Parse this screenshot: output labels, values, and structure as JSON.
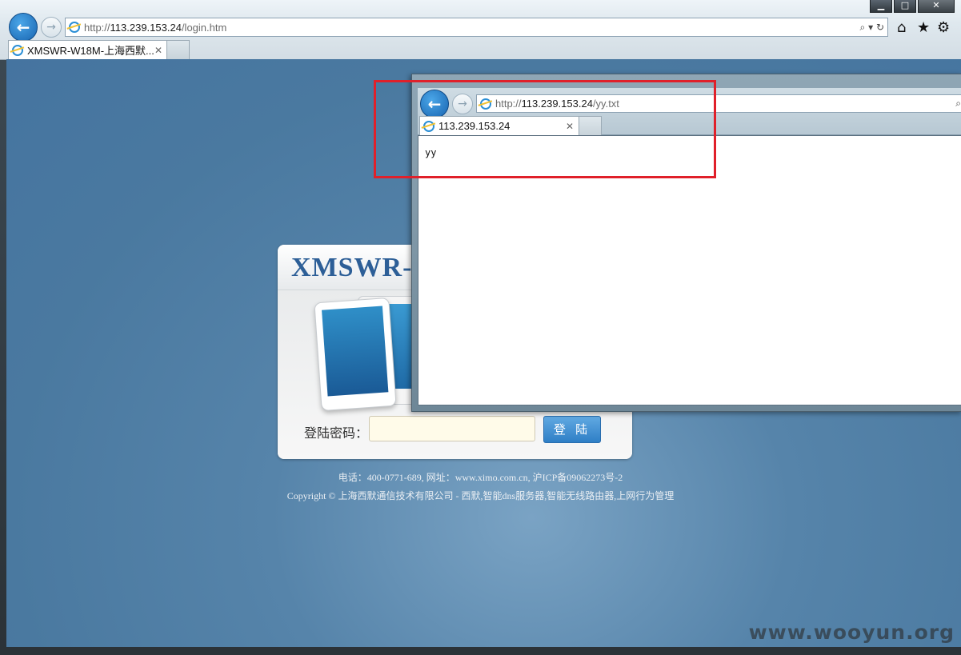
{
  "window_controls": {
    "minimize": "▁",
    "maximize": "□",
    "close": "✕"
  },
  "main_browser": {
    "url_prefix": "http://",
    "url_host": "113.239.153.24",
    "url_path": "/login.htm",
    "tab_title": "XMSWR-W18M-上海西默...",
    "search_icon_glyph": "⌕",
    "refresh_glyph": "↻"
  },
  "login": {
    "brand": "XMSWR-",
    "password_label": "登陆密码：",
    "password_value": "",
    "login_button": "登 陆"
  },
  "footer": {
    "line1": "电话：400-0771-689, 网址：www.ximo.com.cn, 沪ICP备09062273号-2",
    "line2": "Copyright © 上海西默通信技术有限公司 - 西默,智能dns服务器,智能无线路由器,上网行为管理"
  },
  "popup_browser": {
    "url_prefix": "http://",
    "url_host": "113.239.153.24",
    "url_path": "/yy.txt",
    "tab_title": "113.239.153.24",
    "content": "yy"
  },
  "watermark": "www.wooyun.org",
  "colors": {
    "highlight_box": "#e0202a",
    "page_bg": "#4a79a0",
    "login_button": "#2f7fc6"
  }
}
